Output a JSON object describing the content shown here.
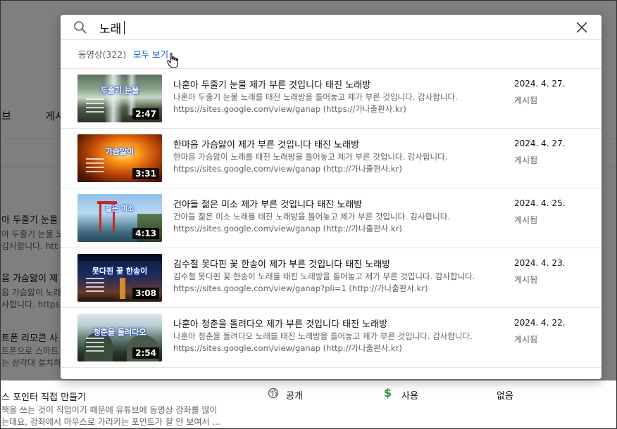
{
  "search": {
    "query": "노래",
    "placeholder": ""
  },
  "filter": {
    "count_label": "동영상(322)",
    "show_all_label": "모두 보기"
  },
  "results": [
    {
      "thumb_title": "두줄기 눈물",
      "duration": "2:47",
      "title": "나훈아 두줄기 눈물 제가 부른 것입니다 태진 노래방",
      "description": "나훈아 두줄기 눈물 노래를 태진 노래방을 틀어놓고 제가 부른 것입니다. 감사합니다. https://sites.google.com/view/ganap (https://가나출판사.kr)",
      "date": "2024. 4. 27.",
      "status": "게시됨"
    },
    {
      "thumb_title": "가슴앓이",
      "duration": "3:31",
      "title": "한마음 가슴앓이 제가 부른 것입니다 태진 노래방",
      "description": "한마음 가슴앓이 노래를 태진 노래방을 틀어놓고 제가 부른 것입니다. 감사합니다. https://sites.google.com/view/ganap (http://가나출판사.kr)",
      "date": "2024. 4. 27.",
      "status": "게시됨"
    },
    {
      "thumb_title": "젊은 미소",
      "duration": "4:13",
      "title": "건아들 젊은 미소 제가 부른 것입니다 태진 노래방",
      "description": "건아들 젊은 미소 노래를 태진 노래방을 틀어놓고 제가 부른 것입니다. 감사합니다. https://sites.google.com/view/ganap (http://가나출판사.kr)",
      "date": "2024. 4. 25.",
      "status": "게시됨"
    },
    {
      "thumb_title": "못다핀 꽃 한송이",
      "duration": "3:08",
      "title": "김수철 못다핀 꽃 한송이 제가 부른 것입니다 태진 노래방",
      "description": "김수철 못다핀 꽃 한송이 노래를 태진 노래방을 틀어놓고 제가 부른 것입니다. 감사합니다. https://sites.google.com/view/ganap?pli=1 (http://가나출판사.kr)",
      "date": "2024. 4. 23.",
      "status": "게시됨"
    },
    {
      "thumb_title": "청춘을 돌려다오",
      "duration": "2:54",
      "title": "나훈아 청춘을 돌려다오 제가 부른 것입니다 태진 노래방",
      "description": "나훈아 청춘을 돌려다오 노래를 태진 노래방을 틀어놓고 제가 부른 것입니다. 감사합니다. https://sites.google.com/view/ganap (http://가나출판사.kr)",
      "date": "2024. 4. 22.",
      "status": "게시됨"
    }
  ],
  "background": {
    "tab_1": "브",
    "tab_2": "게시",
    "rows": [
      {
        "title": "아 두줄기 눈물",
        "line1": "아 두줄기 눈물 노",
        "line2": "감사합니다. htt"
      },
      {
        "title": "음 가슴앓이 제",
        "line1": "음 가슴앓이 노래",
        "line2": "사합니다. https"
      },
      {
        "title": "트폰 리모콘 사",
        "line1": "트폰으로 스마트",
        "line2": "는 삼각대 설치하"
      }
    ],
    "bottom_row": {
      "title": "스 포인터 직접 만들기",
      "line1": "책을 쓰는 것이 직업이기 때문에 유튜브에 동영상 강좌를 많이",
      "line2": "는데요, 강좌에서 마우스로 가리키는 포인트가 잘 안 보여서 ...",
      "visibility": "공개",
      "monetization": "사용",
      "restrictions": "없음"
    }
  }
}
